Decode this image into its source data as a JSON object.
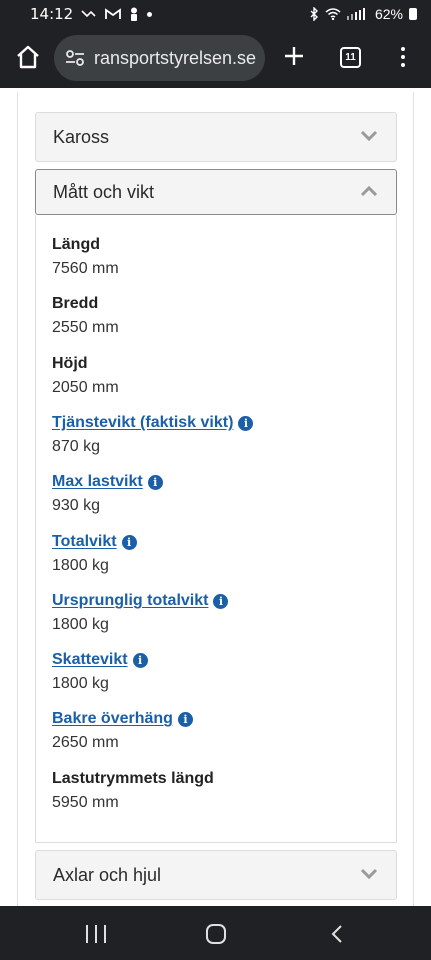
{
  "status": {
    "time": "14:12",
    "battery": "62%"
  },
  "browser": {
    "url": "ransportstyrelsen.se",
    "tab_count": "11"
  },
  "accordions": {
    "kaross": "Kaross",
    "matt_och_vikt": "Mått och vikt",
    "axlar_och_hjul": "Axlar och hjul"
  },
  "fields": [
    {
      "label": "Längd",
      "value": "7560 mm"
    },
    {
      "label": "Bredd",
      "value": "2550 mm"
    },
    {
      "label": "Höjd",
      "value": "2050 mm"
    },
    {
      "label": "Tjänstevikt (faktisk vikt)",
      "value": "870 kg"
    },
    {
      "label": "Max lastvikt",
      "value": "930 kg"
    },
    {
      "label": "Totalvikt",
      "value": "1800 kg"
    },
    {
      "label": "Ursprunglig totalvikt",
      "value": "1800 kg"
    },
    {
      "label": "Skattevikt",
      "value": "1800 kg"
    },
    {
      "label": "Bakre överhäng",
      "value": "2650 mm"
    },
    {
      "label": "Lastutrymmets längd",
      "value": "5950 mm"
    }
  ],
  "icons": {
    "info": "info-icon",
    "chevron_down": "chevron-down-icon",
    "chevron_up": "chevron-up-icon"
  },
  "colors": {
    "link": "#1b5fa8",
    "chrome_bar": "#202124"
  }
}
